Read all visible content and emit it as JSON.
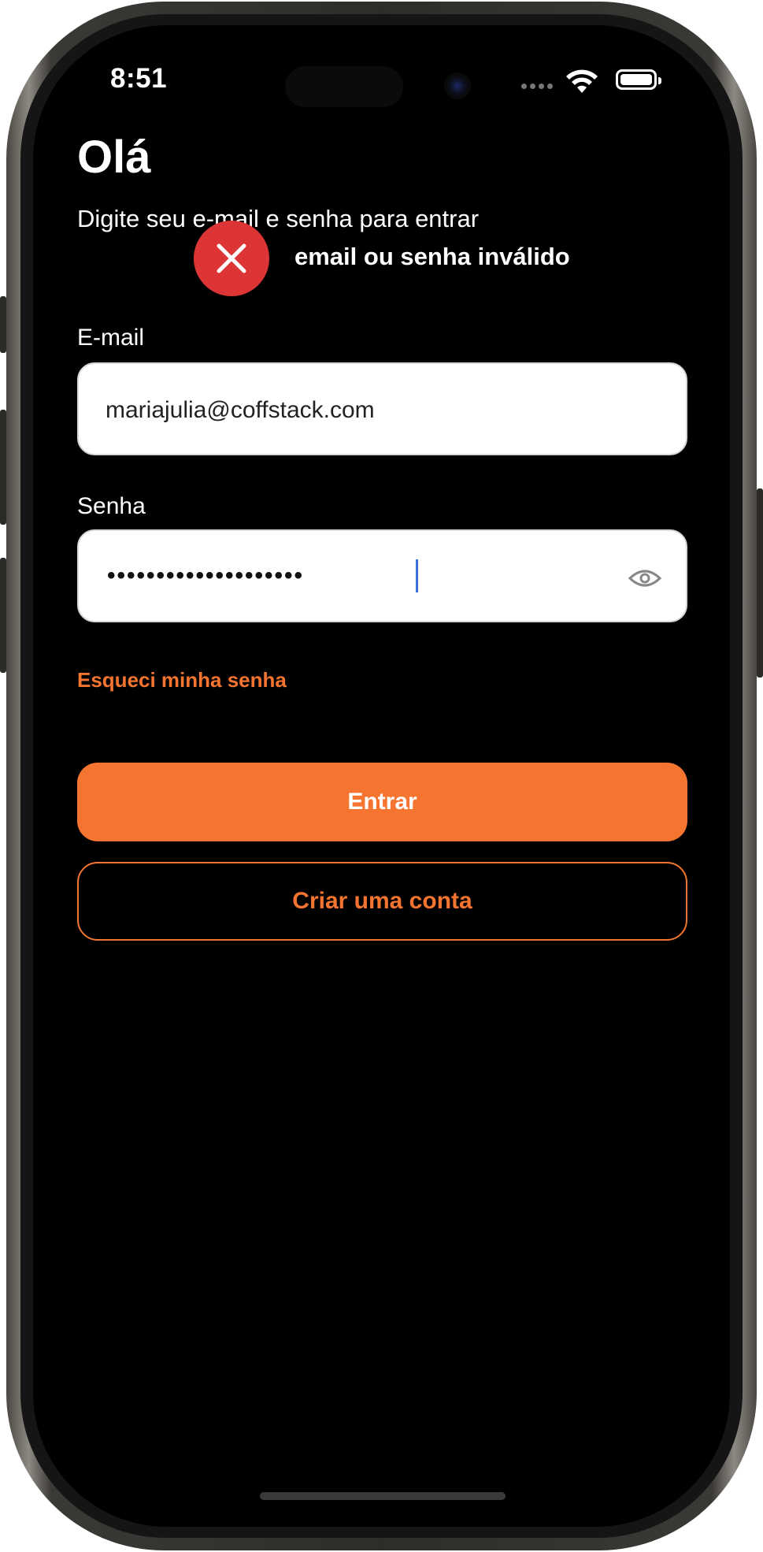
{
  "status_bar": {
    "time": "8:51",
    "icons": [
      "cellular-icon",
      "wifi-icon",
      "battery-icon"
    ]
  },
  "header": {
    "title": "Olá",
    "subtitle": "Digite seu e-mail e senha para entrar"
  },
  "toast": {
    "icon": "error-x-icon",
    "message": "email ou senha inválido",
    "color": "#dd3535"
  },
  "form": {
    "email_label": "E-mail",
    "email_value": "mariajulia@coffstack.com",
    "password_label": "Senha",
    "password_mask": "••••••••••••••••••••",
    "password_toggle_icon": "eye-icon",
    "forgot_link": "Esqueci minha senha"
  },
  "actions": {
    "login_label": "Entrar",
    "signup_label": "Criar uma conta"
  },
  "colors": {
    "accent": "#f47430",
    "background": "#000000",
    "error": "#dd3535"
  }
}
